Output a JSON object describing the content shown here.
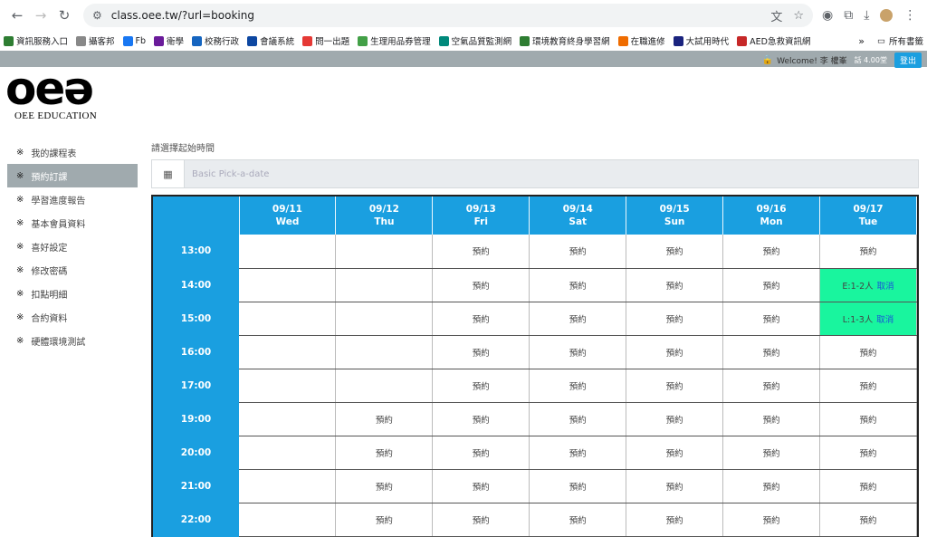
{
  "browser": {
    "url": "class.oee.tw/?url=booking",
    "bookmarks": [
      {
        "label": "資訊服務入口",
        "color": "#2e7d32"
      },
      {
        "label": "攝客邦",
        "color": "#888888"
      },
      {
        "label": "Fb",
        "color": "#1877f2"
      },
      {
        "label": "衛學",
        "color": "#6a1b9a"
      },
      {
        "label": "校務行政",
        "color": "#1565c0"
      },
      {
        "label": "會議系統",
        "color": "#0d47a1"
      },
      {
        "label": "問一出題",
        "color": "#e53935"
      },
      {
        "label": "生理用品券管理",
        "color": "#43a047"
      },
      {
        "label": "空氣品質監測網",
        "color": "#00897b"
      },
      {
        "label": "環境教育終身學習網",
        "color": "#2e7d32"
      },
      {
        "label": "在職進修",
        "color": "#ef6c00"
      },
      {
        "label": "大試用時代",
        "color": "#1a237e"
      },
      {
        "label": "AED急救資訊網",
        "color": "#c62828"
      }
    ],
    "more_label": "»",
    "all_bookmarks_label": "所有書籤"
  },
  "header": {
    "welcome": "Welcome! 李 權峯",
    "points": "話 4.00堂",
    "logout": "登出"
  },
  "logo": {
    "mark": "oeə",
    "text": "OEE EDUCATION"
  },
  "sidebar": {
    "marker": "※",
    "items": [
      {
        "label": "我的課程表"
      },
      {
        "label": "預約訂課"
      },
      {
        "label": "學習進度報告"
      },
      {
        "label": "基本會員資料"
      },
      {
        "label": "喜好設定"
      },
      {
        "label": "修改密碼"
      },
      {
        "label": "扣點明細"
      },
      {
        "label": "合約資料"
      },
      {
        "label": "硬體環境測試"
      }
    ]
  },
  "main": {
    "date_label": "請選擇起始時間",
    "date_placeholder": "Basic Pick-a-date"
  },
  "schedule": {
    "days": [
      {
        "date": "09/11",
        "day": "Wed"
      },
      {
        "date": "09/12",
        "day": "Thu"
      },
      {
        "date": "09/13",
        "day": "Fri"
      },
      {
        "date": "09/14",
        "day": "Sat"
      },
      {
        "date": "09/15",
        "day": "Sun"
      },
      {
        "date": "09/16",
        "day": "Mon"
      },
      {
        "date": "09/17",
        "day": "Tue"
      }
    ],
    "rows": [
      {
        "time": "13:00",
        "cells": [
          "",
          "",
          "預約",
          "預約",
          "預約",
          "預約",
          "預約"
        ]
      },
      {
        "time": "14:00",
        "cells": [
          "",
          "",
          "預約",
          "預約",
          "預約",
          "預約",
          {
            "booked": "E:1-2人",
            "cancel": "取消"
          }
        ]
      },
      {
        "time": "15:00",
        "cells": [
          "",
          "",
          "預約",
          "預約",
          "預約",
          "預約",
          {
            "booked": "L:1-3人",
            "cancel": "取消"
          }
        ]
      },
      {
        "time": "16:00",
        "cells": [
          "",
          "",
          "預約",
          "預約",
          "預約",
          "預約",
          "預約"
        ]
      },
      {
        "time": "17:00",
        "cells": [
          "",
          "",
          "預約",
          "預約",
          "預約",
          "預約",
          "預約"
        ]
      },
      {
        "time": "19:00",
        "cells": [
          "",
          "預約",
          "預約",
          "預約",
          "預約",
          "預約",
          "預約"
        ]
      },
      {
        "time": "20:00",
        "cells": [
          "",
          "預約",
          "預約",
          "預約",
          "預約",
          "預約",
          "預約"
        ]
      },
      {
        "time": "21:00",
        "cells": [
          "",
          "預約",
          "預約",
          "預約",
          "預約",
          "預約",
          "預約"
        ]
      },
      {
        "time": "22:00",
        "cells": [
          "",
          "預約",
          "預約",
          "預約",
          "預約",
          "預約",
          "預約"
        ]
      }
    ]
  }
}
